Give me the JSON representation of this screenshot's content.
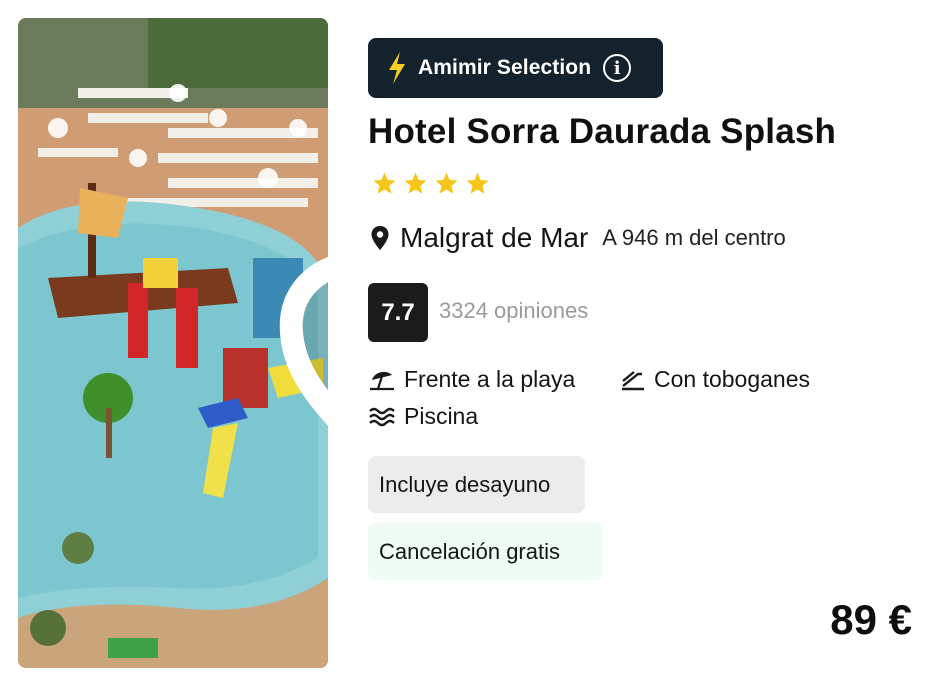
{
  "hotel": {
    "badge_label": "Amimir Selection",
    "badge_icon": "lightning-bolt-icon",
    "info_glyph": "i",
    "name": "Hotel Sorra Daurada Splash",
    "stars": 4,
    "location": "Malgrat de Mar",
    "distance": "A 946 m del centro",
    "score": "7.7",
    "reviews": "3324 opiniones",
    "features": [
      {
        "label": "Frente a la playa",
        "icon": "beach-umbrella-icon"
      },
      {
        "label": "Con toboganes",
        "icon": "water-slide-icon"
      },
      {
        "label": "Piscina",
        "icon": "waves-icon"
      }
    ],
    "tags": [
      "Incluye desayuno",
      "Cancelación gratis"
    ],
    "price": "89 €"
  },
  "colors": {
    "badge_bg": "#14222d",
    "star": "#f5c518",
    "score_bg": "#1b1b1b",
    "tag_gray": "#ececec",
    "tag_green": "#eefcf3",
    "bolt": "#f5d020"
  }
}
